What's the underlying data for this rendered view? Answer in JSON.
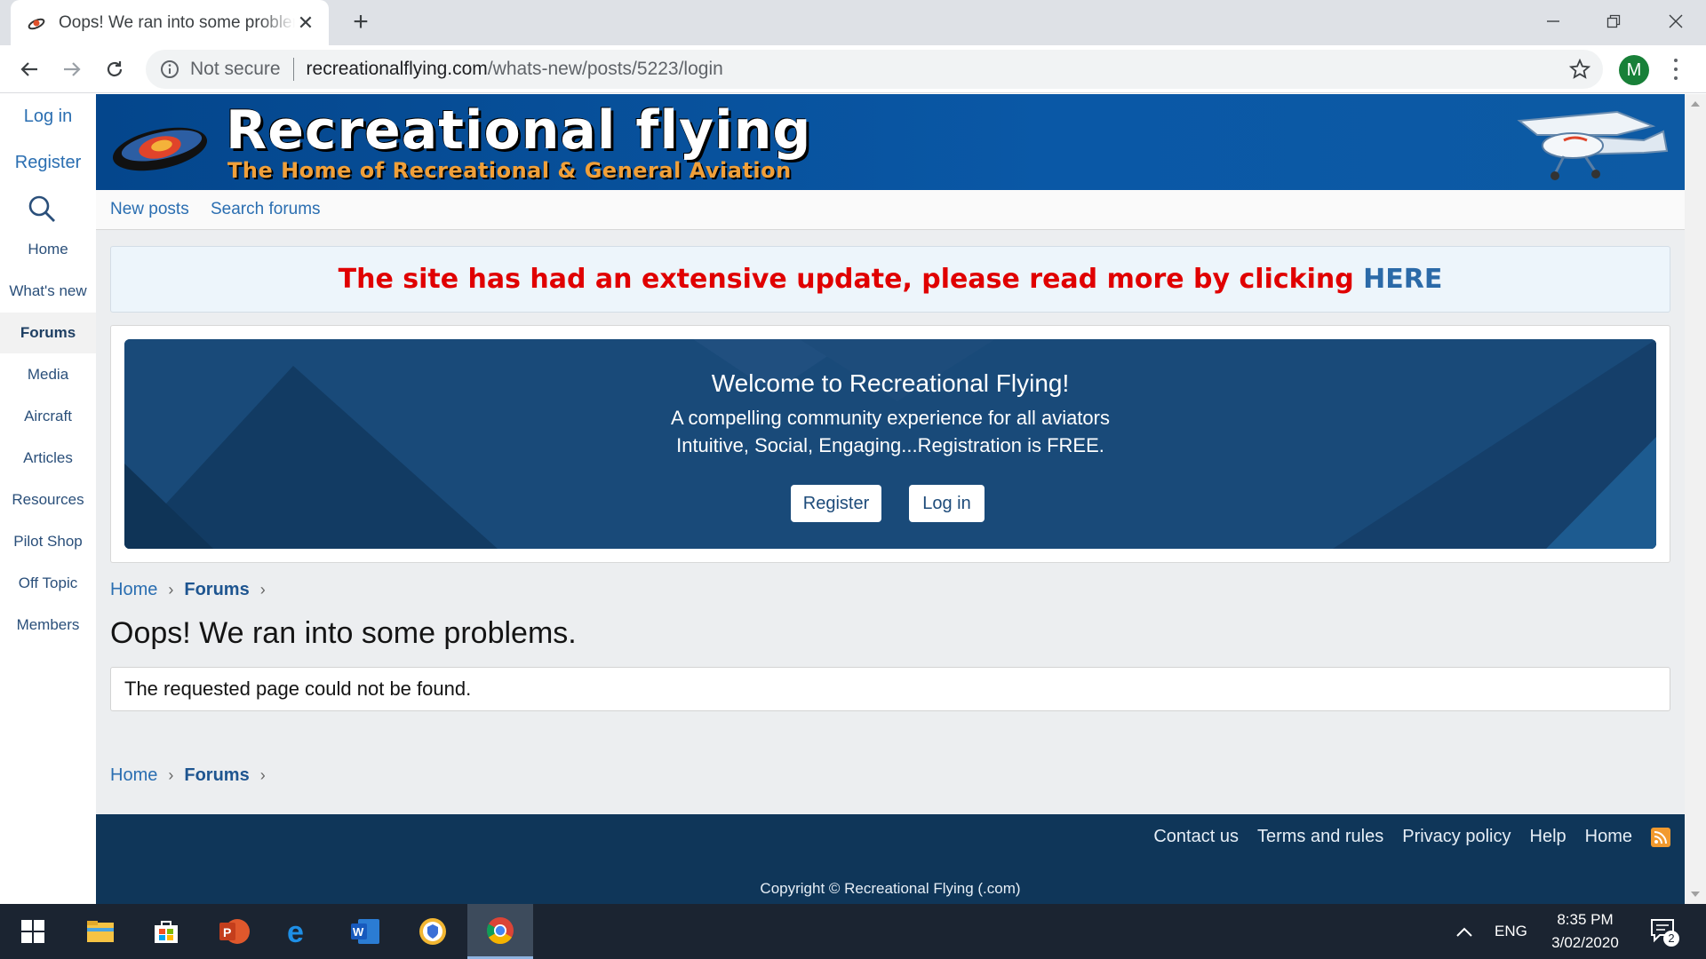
{
  "browser": {
    "tab_title": "Oops! We ran into some problems.",
    "not_secure": "Not secure",
    "url_domain": "recreationalflying.com",
    "url_path": "/whats-new/posts/5223/login",
    "profile_initial": "M"
  },
  "sidebar": {
    "login": "Log in",
    "register": "Register",
    "items": [
      {
        "label": "Home"
      },
      {
        "label": "What's new"
      },
      {
        "label": "Forums"
      },
      {
        "label": "Media"
      },
      {
        "label": "Aircraft"
      },
      {
        "label": "Articles"
      },
      {
        "label": "Resources"
      },
      {
        "label": "Pilot Shop"
      },
      {
        "label": "Off Topic"
      },
      {
        "label": "Members"
      }
    ]
  },
  "header": {
    "title": "Recreational flying",
    "subtitle": "The Home of Recreational & General Aviation"
  },
  "subnav": {
    "new_posts": "New posts",
    "search_forums": "Search forums"
  },
  "notice": {
    "text": "The site has had an extensive update, please read more by clicking",
    "link": "HERE"
  },
  "welcome": {
    "title": "Welcome to Recreational Flying!",
    "line1": "A compelling community experience for all aviators",
    "line2": "Intuitive, Social, Engaging...Registration is FREE.",
    "register": "Register",
    "login": "Log in"
  },
  "breadcrumb": {
    "home": "Home",
    "forums": "Forums"
  },
  "page_title": "Oops! We ran into some problems.",
  "error_message": "The requested page could not be found.",
  "footer": {
    "links": [
      "Contact us",
      "Terms and rules",
      "Privacy policy",
      "Help",
      "Home"
    ],
    "copyright": "Copyright © Recreational Flying (.com)"
  },
  "taskbar": {
    "language": "ENG",
    "time": "8:35 PM",
    "date": "3/02/2020",
    "notification_count": "2"
  },
  "colors": {
    "banner_blue": "#0d5aa4",
    "notice_red": "#e00000",
    "link_blue": "#2a6eb1",
    "footer_navy": "#0f3659"
  }
}
